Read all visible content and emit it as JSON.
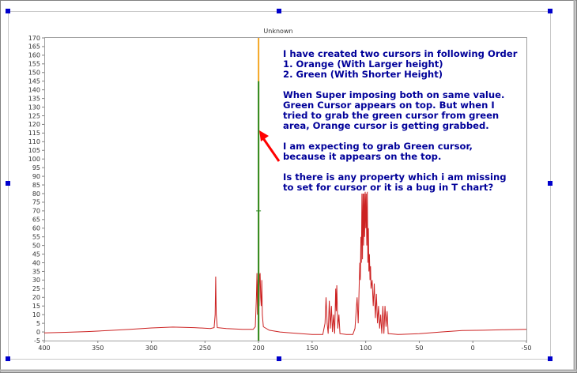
{
  "colors": {
    "spectrum": "#cc2222",
    "orange_cursor": "#f5a623",
    "green_cursor": "#2e8b22",
    "annotation_text": "#000099",
    "arrow": "#ff0000",
    "selection_handle": "#0000cc"
  },
  "icons": {
    "selection_handles": "small-square-handle-icon"
  },
  "annotation": {
    "line1": "I have created two cursors in following Order",
    "line2": "1. Orange (With Larger height)",
    "line3": "2. Green (With Shorter Height)",
    "line4": "When Super imposing both on same value.",
    "line5": "Green Cursor appears on top. But when I",
    "line6": "tried to grab the green cursor from green",
    "line7": "area, Orange cursor is getting grabbed.",
    "line8": "I am expecting to grab Green cursor,",
    "line9": "because it appears on the top.",
    "line10": "Is there is any property which i am missing",
    "line11": "to set for cursor or it is a bug in T chart?"
  },
  "chart_data": {
    "type": "line",
    "title": "Unknown",
    "xlabel": "",
    "ylabel": "",
    "xlim": [
      400,
      -50
    ],
    "ylim": [
      -5,
      170
    ],
    "x_reversed": true,
    "grid": false,
    "x_ticks": [
      400,
      350,
      300,
      250,
      200,
      150,
      100,
      50,
      0,
      -50
    ],
    "y_ticks": [
      -5,
      0,
      5,
      10,
      15,
      20,
      25,
      30,
      35,
      40,
      45,
      50,
      55,
      60,
      65,
      70,
      75,
      80,
      85,
      90,
      95,
      100,
      105,
      110,
      115,
      120,
      125,
      130,
      135,
      140,
      145,
      150,
      155,
      160,
      165,
      170
    ],
    "series": [
      {
        "color": "#cc2222",
        "points": [
          [
            400,
            -0.5
          ],
          [
            380,
            -0.2
          ],
          [
            360,
            0.2
          ],
          [
            340,
            0.8
          ],
          [
            320,
            1.5
          ],
          [
            300,
            2.3
          ],
          [
            280,
            2.8
          ],
          [
            260,
            2.5
          ],
          [
            245,
            2.0
          ],
          [
            241.5,
            2.5
          ],
          [
            240.5,
            10
          ],
          [
            240,
            32
          ],
          [
            239.5,
            10
          ],
          [
            238.5,
            2.5
          ],
          [
            230,
            2.0
          ],
          [
            215,
            1.5
          ],
          [
            205,
            1.5
          ],
          [
            203,
            3
          ],
          [
            202,
            20
          ],
          [
            201.5,
            34
          ],
          [
            201,
            10
          ],
          [
            200.5,
            30
          ],
          [
            200,
            33
          ],
          [
            199.5,
            15
          ],
          [
            199,
            33
          ],
          [
            198.5,
            34
          ],
          [
            198,
            20
          ],
          [
            197.5,
            15
          ],
          [
            197,
            30
          ],
          [
            196.5,
            10
          ],
          [
            195.5,
            3
          ],
          [
            190,
            1
          ],
          [
            180,
            0
          ],
          [
            170,
            -0.5
          ],
          [
            160,
            -1
          ],
          [
            150,
            -1.5
          ],
          [
            140,
            -1.5
          ],
          [
            138,
            5
          ],
          [
            137,
            20
          ],
          [
            136,
            5
          ],
          [
            135,
            -1
          ],
          [
            134,
            18
          ],
          [
            133,
            2
          ],
          [
            132,
            15
          ],
          [
            131,
            0
          ],
          [
            130,
            10
          ],
          [
            129,
            -1
          ],
          [
            128,
            25
          ],
          [
            127.5,
            12
          ],
          [
            127,
            27
          ],
          [
            126,
            2
          ],
          [
            125,
            10
          ],
          [
            124,
            -1
          ],
          [
            118,
            -1.5
          ],
          [
            112,
            -1.5
          ],
          [
            110,
            2
          ],
          [
            108,
            20
          ],
          [
            107,
            5
          ],
          [
            106,
            28
          ],
          [
            105.5,
            40
          ],
          [
            105,
            30
          ],
          [
            104.5,
            55
          ],
          [
            104,
            40
          ],
          [
            103.5,
            80
          ],
          [
            103,
            42
          ],
          [
            102.5,
            80
          ],
          [
            102,
            50
          ],
          [
            101.5,
            80
          ],
          [
            101,
            55
          ],
          [
            100.5,
            81
          ],
          [
            100,
            60
          ],
          [
            99.5,
            80
          ],
          [
            99,
            50
          ],
          [
            98.5,
            81
          ],
          [
            98,
            40
          ],
          [
            97.5,
            60
          ],
          [
            97,
            35
          ],
          [
            96.5,
            45
          ],
          [
            96,
            30
          ],
          [
            95.5,
            38
          ],
          [
            95,
            25
          ],
          [
            94,
            30
          ],
          [
            93,
            15
          ],
          [
            92,
            28
          ],
          [
            91,
            8
          ],
          [
            90,
            22
          ],
          [
            89,
            5
          ],
          [
            88,
            15
          ],
          [
            87,
            2
          ],
          [
            86,
            10
          ],
          [
            85,
            -1
          ],
          [
            84,
            15
          ],
          [
            83,
            -1
          ],
          [
            82,
            15
          ],
          [
            81,
            3
          ],
          [
            80,
            12
          ],
          [
            79,
            -1
          ],
          [
            78,
            -1
          ],
          [
            70,
            -1.5
          ],
          [
            50,
            -1
          ],
          [
            30,
            0
          ],
          [
            10,
            0.8
          ],
          [
            -10,
            1
          ],
          [
            -30,
            1.3
          ],
          [
            -50,
            1.5
          ]
        ]
      }
    ],
    "cursors": [
      {
        "color": "orange",
        "x": 200,
        "y_from": -5,
        "y_to": 170
      },
      {
        "color": "green",
        "x": 200,
        "y_from": -5,
        "y_to": 145
      }
    ]
  }
}
